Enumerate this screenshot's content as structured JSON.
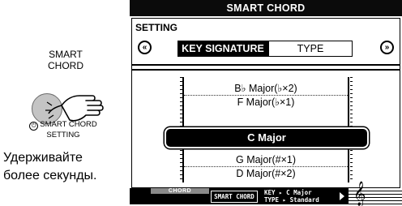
{
  "button": {
    "label_line1": "SMART",
    "label_line2": "CHORD",
    "hold_caption_line1": "SMART CHORD",
    "hold_caption_line2": "SETTING",
    "hold_icon": "power-hold-icon"
  },
  "instruction": {
    "line1": "Удерживайте",
    "line2": "более секунды."
  },
  "screen": {
    "title": "SMART CHORD",
    "setting_label": "SETTING",
    "tabs": [
      {
        "label": "KEY SIGNATURE",
        "active": true
      },
      {
        "label": "TYPE",
        "active": false
      }
    ],
    "key_list": {
      "items_above": [
        "B♭ Major(♭×2)",
        "F Major(♭×1)"
      ],
      "selected": "C Major",
      "items_below": [
        "G Major(#×1)",
        "D Major(#×2)"
      ]
    },
    "status": {
      "chord_tab": "CHORD",
      "mode_box": "SMART CHORD",
      "key_line": "KEY  ▸ C Major",
      "type_line": "TYPE ▸ Standard"
    }
  }
}
